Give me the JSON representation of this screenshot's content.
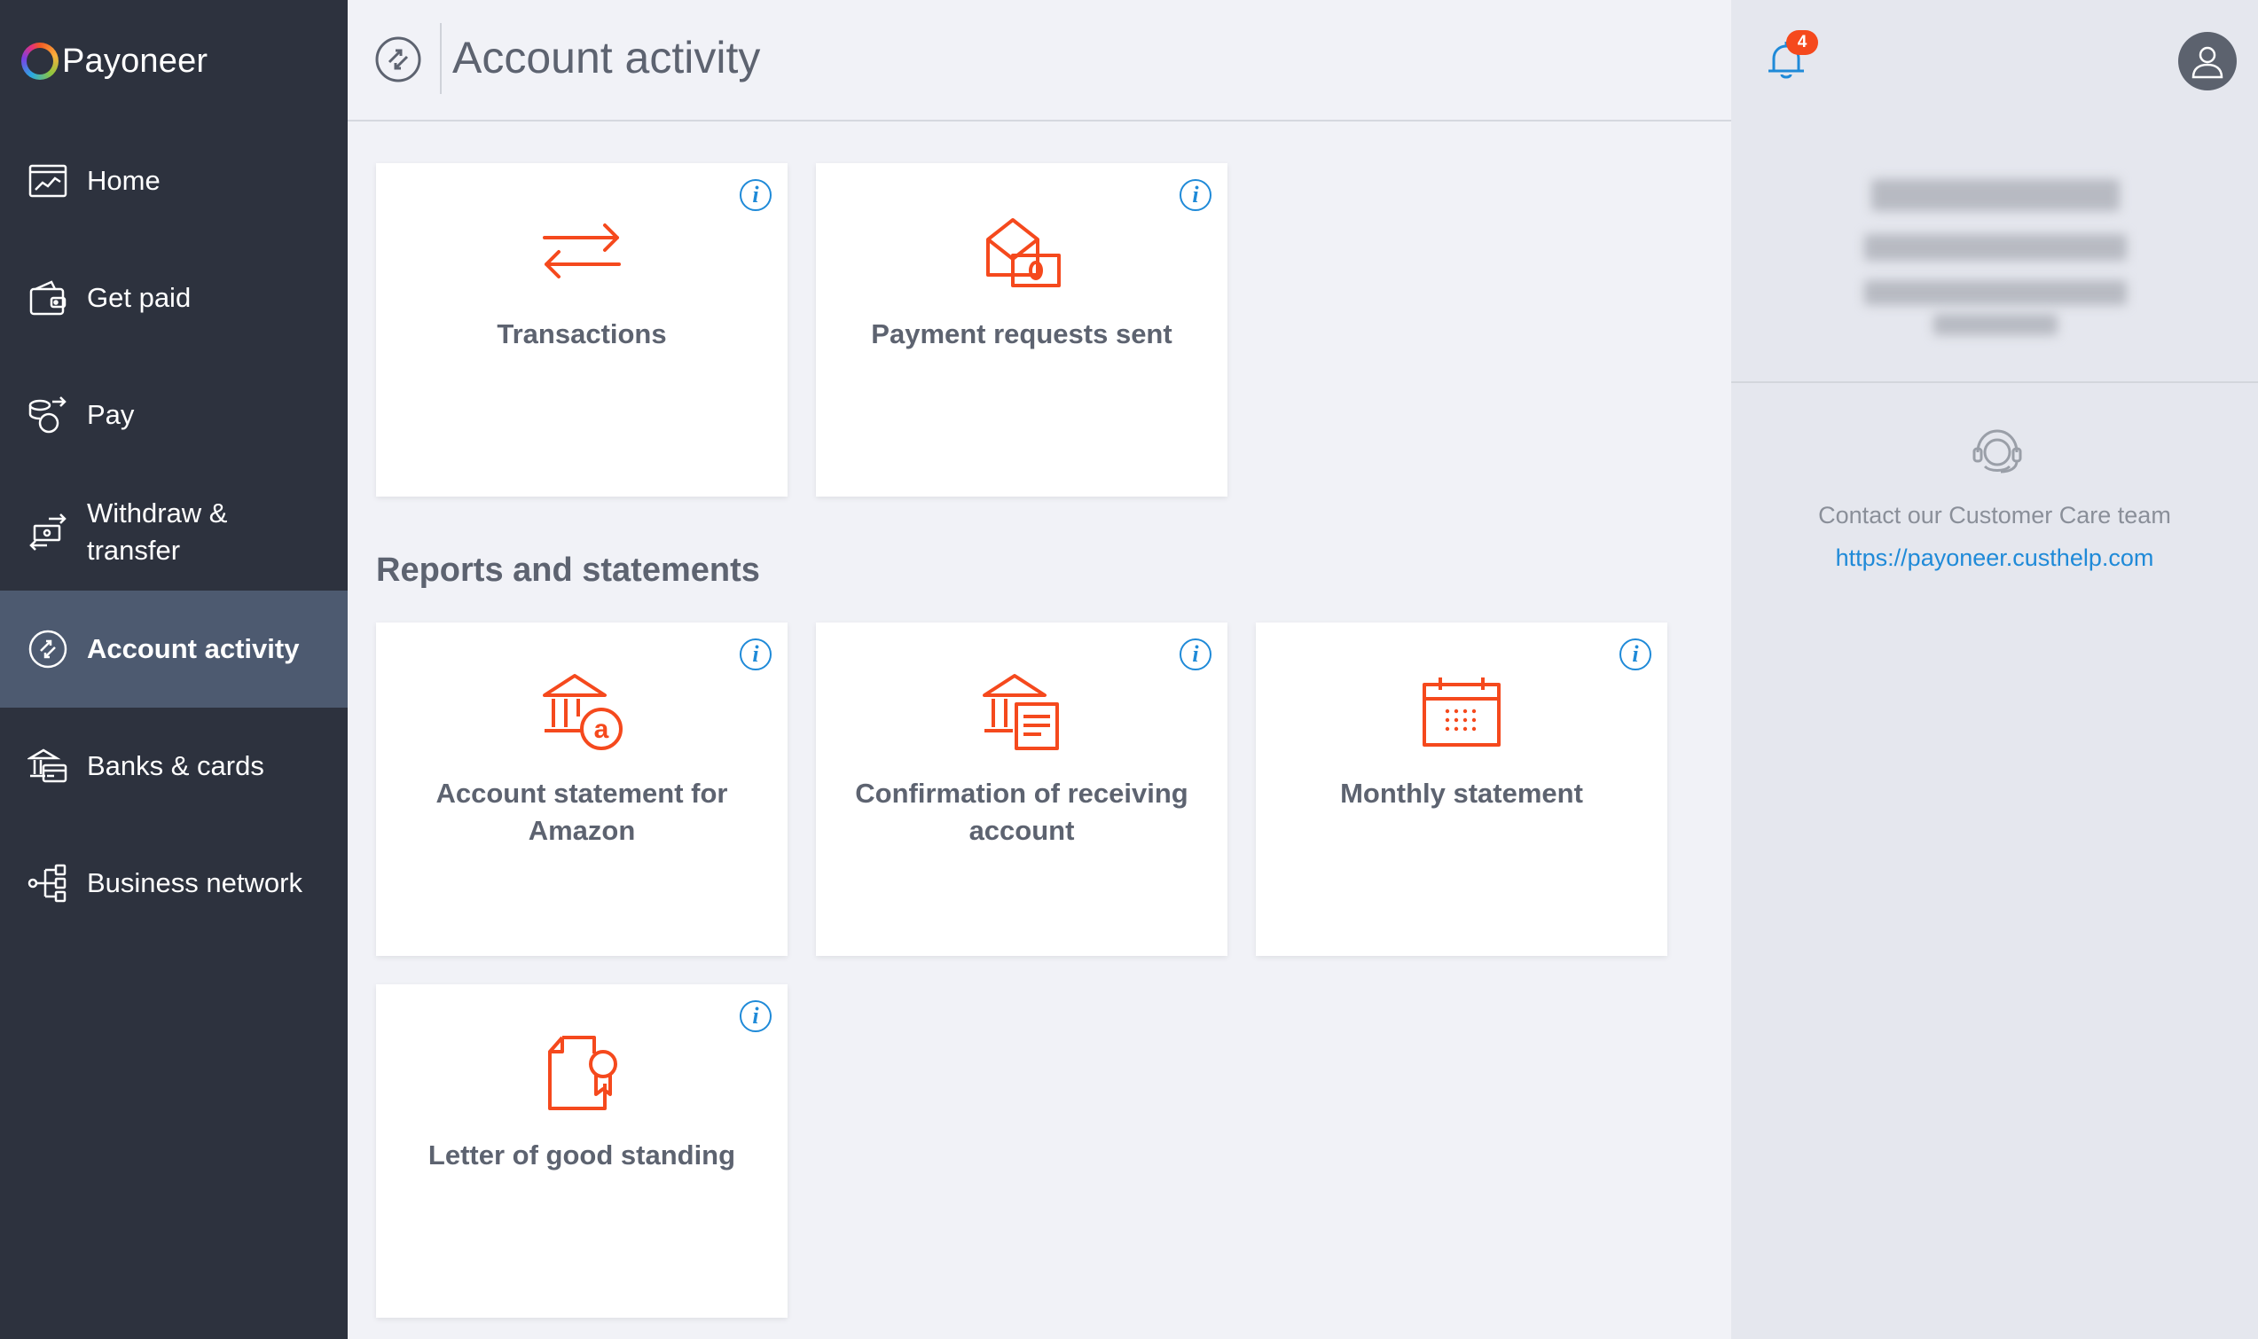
{
  "brand": {
    "name": "Payoneer"
  },
  "sidebar": {
    "items": [
      {
        "label": "Home",
        "icon": "chart-window-icon"
      },
      {
        "label": "Get paid",
        "icon": "wallet-icon"
      },
      {
        "label": "Pay",
        "icon": "coins-arrow-icon"
      },
      {
        "label": "Withdraw & transfer",
        "icon": "cash-transfer-icon"
      },
      {
        "label": "Account activity",
        "icon": "activity-circle-icon",
        "active": true
      },
      {
        "label": "Banks & cards",
        "icon": "bank-card-icon"
      },
      {
        "label": "Business network",
        "icon": "network-icon"
      }
    ]
  },
  "header": {
    "title": "Account activity",
    "icon": "activity-circle-icon"
  },
  "cards": [
    {
      "label": "Transactions",
      "icon": "arrows-exchange-icon"
    },
    {
      "label": "Payment requests sent",
      "icon": "envelope-money-icon"
    }
  ],
  "reports": {
    "title": "Reports and statements",
    "cards": [
      {
        "label": "Account statement for Amazon",
        "icon": "bank-amazon-icon"
      },
      {
        "label": "Confirmation of receiving account",
        "icon": "bank-document-icon"
      },
      {
        "label": "Monthly statement",
        "icon": "calendar-icon"
      },
      {
        "label": "Letter of good standing",
        "icon": "certificate-icon"
      }
    ]
  },
  "info_glyph": "i",
  "right_panel": {
    "notifications_count": "4",
    "support_text": "Contact our Customer Care team",
    "support_link": "https://payoneer.custhelp.com"
  },
  "colors": {
    "accent": "#f5491d",
    "sidebar_bg": "#2d323e",
    "sidebar_active": "#4d5a70",
    "link": "#1f8ad8",
    "text": "#5d6370"
  }
}
